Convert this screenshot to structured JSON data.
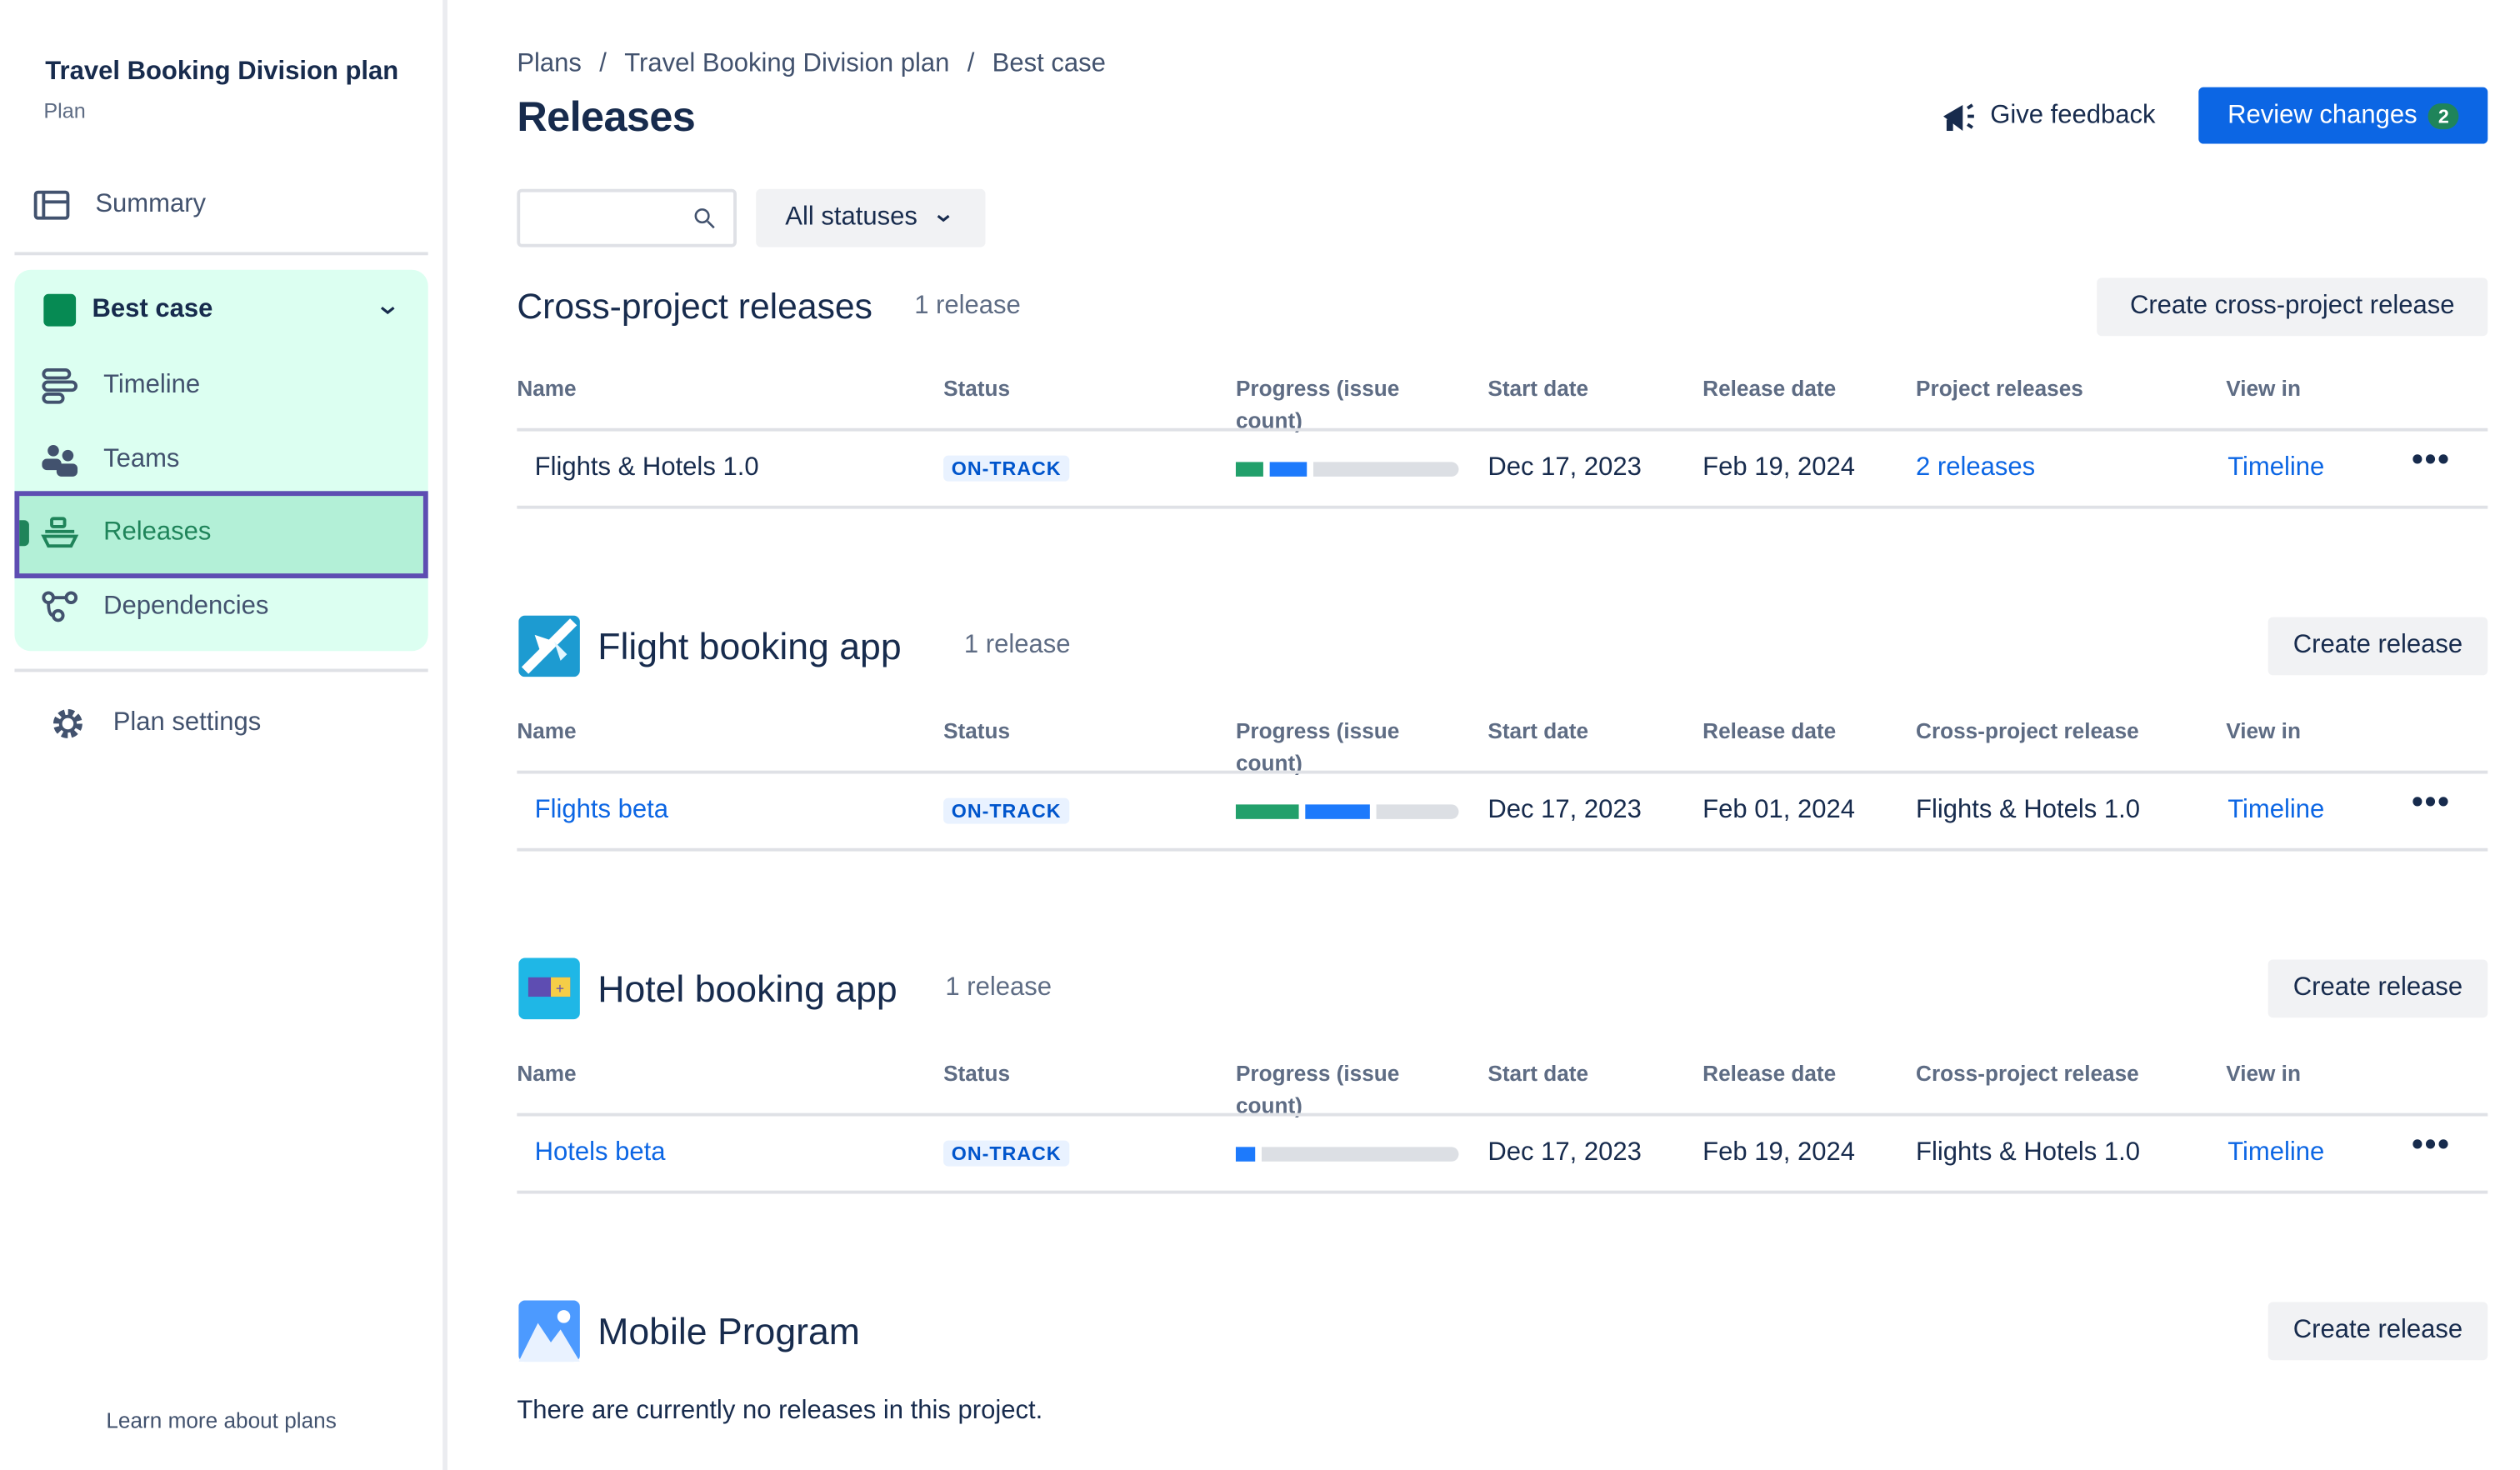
{
  "sidebar": {
    "plan_title": "Travel Booking Division plan",
    "plan_subtitle": "Plan",
    "summary": "Summary",
    "scenario": {
      "label": "Best case",
      "color": "#068a53"
    },
    "items": [
      {
        "label": "Timeline",
        "icon": "timeline-icon"
      },
      {
        "label": "Teams",
        "icon": "teams-icon"
      },
      {
        "label": "Releases",
        "icon": "ship-icon",
        "selected": true
      },
      {
        "label": "Dependencies",
        "icon": "dependencies-icon"
      }
    ],
    "settings": "Plan settings",
    "learn_more": "Learn more about plans"
  },
  "header": {
    "breadcrumbs": [
      "Plans",
      "Travel Booking Division plan",
      "Best case"
    ],
    "separator": "/",
    "title": "Releases",
    "feedback": "Give feedback",
    "review": "Review changes",
    "review_count": "2"
  },
  "filters": {
    "search_placeholder": "",
    "status": "All statuses"
  },
  "colors": {
    "accent": "#0c66e4",
    "done": "#22a06b",
    "in_progress": "#1d7afc",
    "todo": "#dcdfe4",
    "selected_outline": "#5e4db2"
  },
  "cross_project": {
    "title": "Cross-project releases",
    "count": "1 release",
    "create": "Create cross-project release",
    "columns": [
      "Name",
      "Status",
      "Progress (issue count)",
      "Start date",
      "Release date",
      "Project releases",
      "View in"
    ],
    "rows": [
      {
        "name": "Flights & Hotels 1.0",
        "status": "ON-TRACK",
        "progress": {
          "done": 12,
          "in_progress": 17
        },
        "start": "Dec 17, 2023",
        "release": "Feb 19, 2024",
        "related": "2 releases",
        "view_in": "Timeline"
      }
    ]
  },
  "projects": [
    {
      "title": "Flight booking app",
      "count": "1 release",
      "create": "Create release",
      "icon": "flight-app-icon",
      "columns": [
        "Name",
        "Status",
        "Progress (issue count)",
        "Start date",
        "Release date",
        "Cross-project release",
        "View in"
      ],
      "rows": [
        {
          "name": "Flights beta",
          "status": "ON-TRACK",
          "progress": {
            "done": 28,
            "in_progress": 29
          },
          "start": "Dec 17, 2023",
          "release": "Feb 01, 2024",
          "related": "Flights & Hotels 1.0",
          "view_in": "Timeline"
        }
      ]
    },
    {
      "title": "Hotel booking app",
      "count": "1 release",
      "create": "Create release",
      "icon": "hotel-app-icon",
      "columns": [
        "Name",
        "Status",
        "Progress (issue count)",
        "Start date",
        "Release date",
        "Cross-project release",
        "View in"
      ],
      "rows": [
        {
          "name": "Hotels beta",
          "status": "ON-TRACK",
          "progress": {
            "done": 0,
            "in_progress": 9
          },
          "start": "Dec 17, 2023",
          "release": "Feb 19, 2024",
          "related": "Flights & Hotels 1.0",
          "view_in": "Timeline"
        }
      ]
    },
    {
      "title": "Mobile Program",
      "create": "Create release",
      "icon": "mobile-program-icon",
      "empty": "There are currently no releases in this project."
    }
  ]
}
